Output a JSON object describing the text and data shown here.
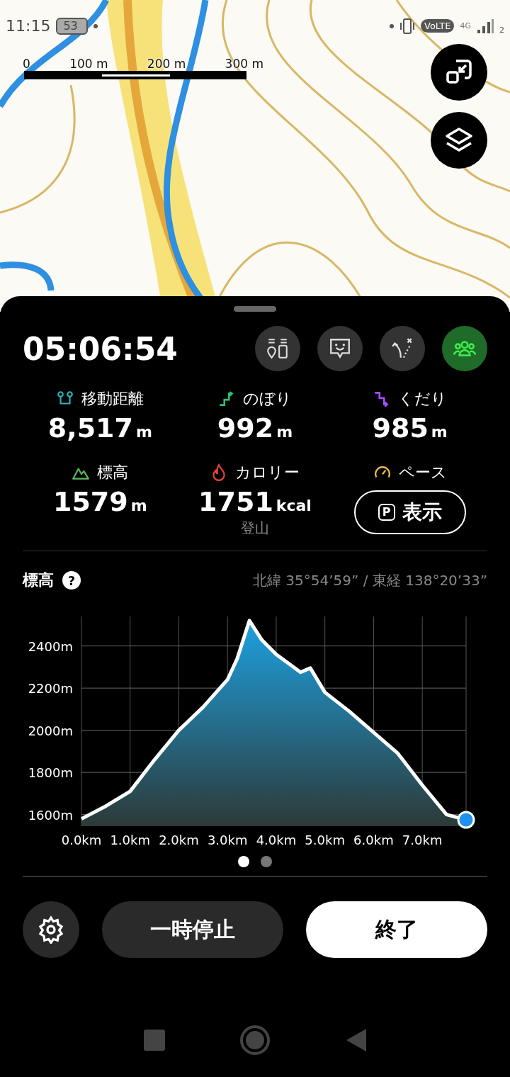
{
  "status_bar": {
    "time": "11:15",
    "battery": "53",
    "network_badge": "VoLTE",
    "network_type": "4G",
    "sim_slot": "2"
  },
  "map": {
    "scale_labels": [
      "0",
      "100 m",
      "200 m",
      "300 m"
    ]
  },
  "timer": "05:06:54",
  "actions": [
    {
      "kind": "markers",
      "selected": false
    },
    {
      "kind": "face",
      "selected": false
    },
    {
      "kind": "route",
      "selected": false
    },
    {
      "kind": "group",
      "selected": true
    }
  ],
  "stats": [
    {
      "kind": "distance",
      "label": "移動距離",
      "value": "8,517",
      "unit": "m"
    },
    {
      "kind": "ascent",
      "label": "のぼり",
      "value": "992",
      "unit": "m"
    },
    {
      "kind": "descent",
      "label": "くだり",
      "value": "985",
      "unit": "m"
    },
    {
      "kind": "altitude",
      "label": "標高",
      "value": "1579",
      "unit": "m"
    },
    {
      "kind": "calorie",
      "label": "カロリー",
      "value": "1751",
      "unit": "kcal",
      "note": "登山"
    },
    {
      "kind": "pace",
      "label": "ペース",
      "badge": "P",
      "button": "表示"
    }
  ],
  "elevation": {
    "title": "標高",
    "help": "?",
    "coordinates": "北緯 35°54’59” / 東経 138°20’33”",
    "chart_data": {
      "type": "area",
      "x": [
        0,
        0.5,
        1.0,
        1.5,
        2.0,
        2.5,
        3.0,
        3.2,
        3.45,
        3.7,
        4.0,
        4.5,
        4.7,
        5.0,
        5.5,
        6.0,
        6.5,
        7.0,
        7.5,
        7.9
      ],
      "grid": true,
      "series": [
        {
          "color": "#1ea0e0",
          "values": [
            1580,
            1640,
            1710,
            1860,
            2000,
            2110,
            2240,
            2340,
            2520,
            2430,
            2360,
            2275,
            2295,
            2180,
            2090,
            1990,
            1890,
            1740,
            1600,
            1575
          ]
        }
      ],
      "xlim": [
        0,
        7.9
      ],
      "ylim": [
        1545,
        2540
      ],
      "xticks": [
        {
          "value": 0,
          "label": "0.0km"
        },
        {
          "value": 1,
          "label": "1.0km"
        },
        {
          "value": 2,
          "label": "2.0km"
        },
        {
          "value": 3,
          "label": "3.0km"
        },
        {
          "value": 4,
          "label": "4.0km"
        },
        {
          "value": 5,
          "label": "5.0km"
        },
        {
          "value": 6,
          "label": "6.0km"
        },
        {
          "value": 7,
          "label": "7.0km"
        }
      ],
      "yticks": [
        {
          "value": 1600,
          "label": "1600m"
        },
        {
          "value": 1800,
          "label": "1800m"
        },
        {
          "value": 2000,
          "label": "2000m"
        },
        {
          "value": 2200,
          "label": "2200m"
        },
        {
          "value": 2400,
          "label": "2400m"
        }
      ]
    },
    "pages": [
      {
        "selected": true
      },
      {
        "selected": false
      }
    ]
  },
  "controls": {
    "pause": "一時停止",
    "finish": "終了"
  }
}
